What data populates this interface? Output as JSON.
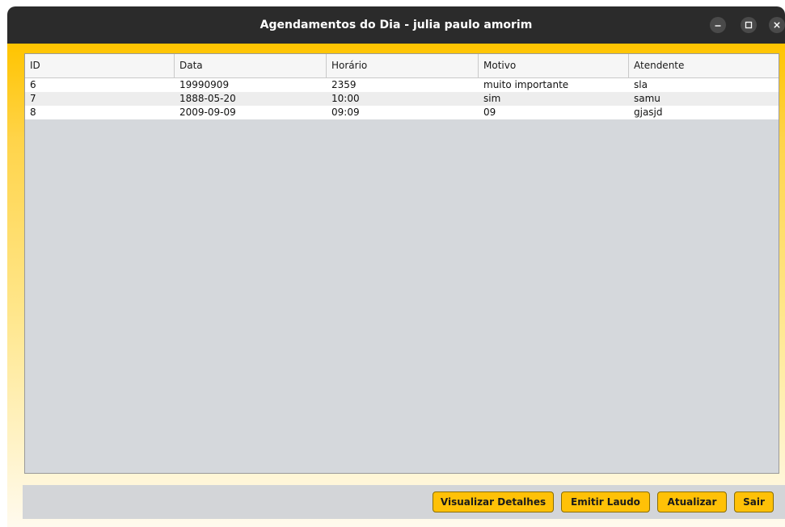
{
  "window": {
    "title": "Agendamentos do Dia - julia paulo amorim",
    "controls": {
      "minimize_icon": "minimize-icon",
      "maximize_icon": "maximize-icon",
      "close_icon": "close-icon"
    }
  },
  "table": {
    "columns": [
      "ID",
      "Data",
      "Horário",
      "Motivo",
      "Atendente"
    ],
    "rows": [
      [
        "6",
        "19990909",
        "2359",
        "muito importante",
        "sla"
      ],
      [
        "7",
        "1888-05-20",
        "10:00",
        "sim",
        "samu"
      ],
      [
        "8",
        "2009-09-09",
        "09:09",
        "09",
        "gjasjd"
      ]
    ]
  },
  "buttons": {
    "details": "Visualizar Detalhes",
    "laudo": "Emitir Laudo",
    "refresh": "Atualizar",
    "exit": "Sair"
  },
  "colors": {
    "titlebar": "#2b2b2b",
    "accent": "#ffc107",
    "table_background": "#d5d8dc"
  }
}
